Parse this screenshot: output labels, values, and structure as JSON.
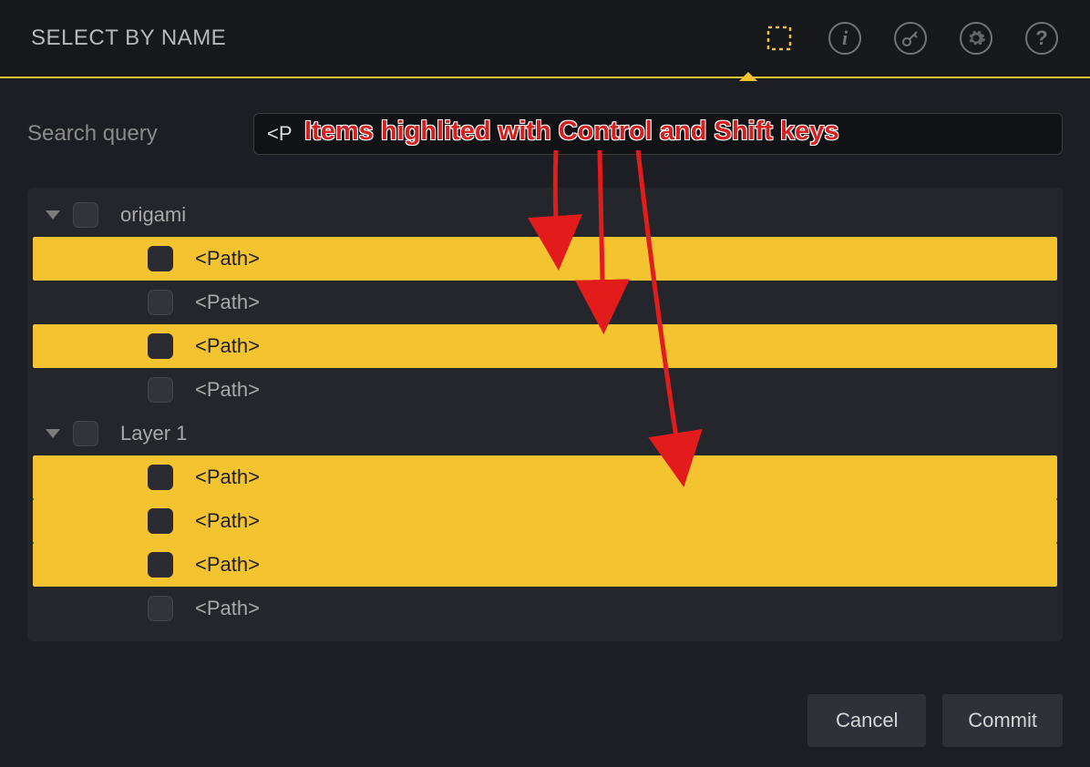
{
  "header": {
    "title": "SELECT BY NAME"
  },
  "search": {
    "label": "Search query",
    "value": "<P"
  },
  "tree": {
    "groups": [
      {
        "name": "origami",
        "items": [
          {
            "label": "<Path>",
            "highlighted": true
          },
          {
            "label": "<Path>",
            "highlighted": false
          },
          {
            "label": "<Path>",
            "highlighted": true
          },
          {
            "label": "<Path>",
            "highlighted": false
          }
        ]
      },
      {
        "name": "Layer 1",
        "items": [
          {
            "label": "<Path>",
            "highlighted": true
          },
          {
            "label": "<Path>",
            "highlighted": true
          },
          {
            "label": "<Path>",
            "highlighted": true
          },
          {
            "label": "<Path>",
            "highlighted": false
          }
        ]
      }
    ]
  },
  "footer": {
    "cancel": "Cancel",
    "commit": "Commit"
  },
  "annotation": {
    "text": "Items highlited with Control and Shift keys"
  }
}
